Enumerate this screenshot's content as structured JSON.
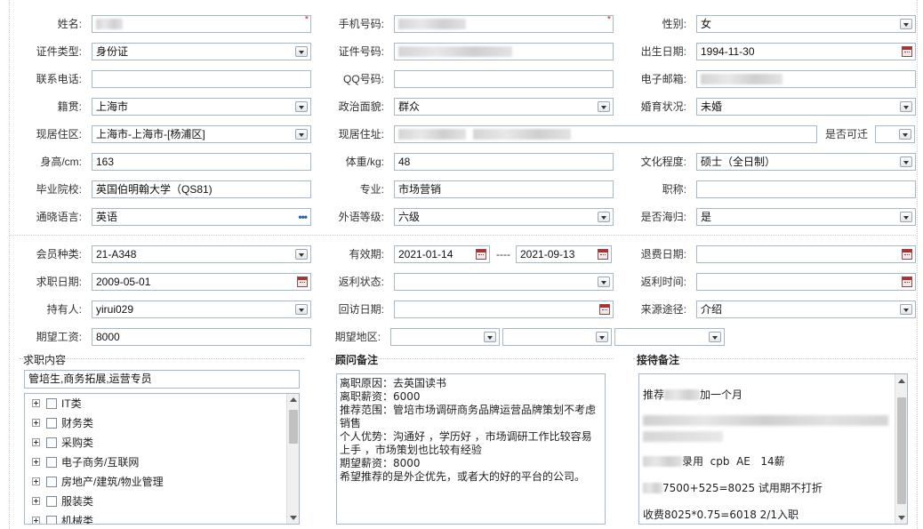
{
  "row1": {
    "name_label": "姓名:",
    "phone_label": "手机号码:",
    "gender_label": "性别:",
    "gender_value": "女"
  },
  "row2": {
    "idtype_label": "证件类型:",
    "idtype_value": "身份证",
    "idno_label": "证件号码:",
    "birth_label": "出生日期:",
    "birth_value": "1994-11-30"
  },
  "row3": {
    "contact_label": "联系电话:",
    "qq_label": "QQ号码:",
    "email_label": "电子邮箱:"
  },
  "row4": {
    "native_label": "籍贯:",
    "native_value": "上海市",
    "political_label": "政治面貌:",
    "political_value": "群众",
    "marital_label": "婚育状况:",
    "marital_value": "未婚"
  },
  "row5": {
    "residence_label": "现居住区:",
    "residence_value": "上海市-上海市-[杨浦区]",
    "address_label": "现居住址:",
    "relocate_label": "是否可迁"
  },
  "row6": {
    "height_label": "身高/cm:",
    "height_value": "163",
    "weight_label": "体重/kg:",
    "weight_value": "48",
    "edu_label": "文化程度:",
    "edu_value": "硕士（全日制）"
  },
  "row7": {
    "school_label": "毕业院校:",
    "school_value": "英国伯明翰大学（QS81)",
    "major_label": "专业:",
    "major_value": "市场营销",
    "title_label": "职称:"
  },
  "row8": {
    "lang_label": "通晓语言:",
    "lang_value": "英语",
    "lang_more": "•••",
    "level_label": "外语等级:",
    "level_value": "六级",
    "overseas_label": "是否海归:",
    "overseas_value": "是"
  },
  "row9": {
    "member_label": "会员种类:",
    "member_value": "21-A348",
    "valid_label": "有效期:",
    "valid_from": "2021-01-14",
    "valid_sep": "----",
    "valid_to": "2021-09-13",
    "refund_label": "退费日期:"
  },
  "row10": {
    "jobdate_label": "求职日期:",
    "jobdate_value": "2009-05-01",
    "rebate_status_label": "返利状态:",
    "rebate_time_label": "返利时间:"
  },
  "row11": {
    "holder_label": "持有人:",
    "holder_value": "yirui029",
    "revisit_label": "回访日期:",
    "source_label": "来源途径:",
    "source_value": "介绍"
  },
  "row12": {
    "salary_label": "期望工资:",
    "salary_value": "8000",
    "region_label": "期望地区:"
  },
  "job_content": {
    "title": "求职内容",
    "summary": "管培生,商务拓展,运营专员",
    "tree": [
      "IT类",
      "财务类",
      "采购类",
      "电子商务/互联网",
      "房地产/建筑/物业管理",
      "服装类",
      "机械类"
    ]
  },
  "consultant_note": {
    "title": "顾问备注",
    "lines": [
      "离职原因：去英国读书",
      "离职薪资：6000",
      "推荐范围：管培市场调研商务品牌运营品牌策划不考虑",
      "销售",
      "个人优势：沟通好 ，学历好 ，市场调研工作比较容易",
      "上手 ，市场策划也比较有经验",
      "期望薪资：8000",
      "希望推荐的是外企优先，或者大的好的平台的公司。"
    ]
  },
  "reception_note": {
    "title": "接待备注",
    "line1_prefix": "推荐",
    "line1_suffix": "加一个月",
    "line2": "录用  cpb  AE   14薪",
    "line3": "7500+525=8025 试用期不打折",
    "line4": "收费8025*0.75=6018 2/1入职"
  },
  "colors": {
    "field_border": "#a8b8cc",
    "required_mark": "#e02020"
  }
}
